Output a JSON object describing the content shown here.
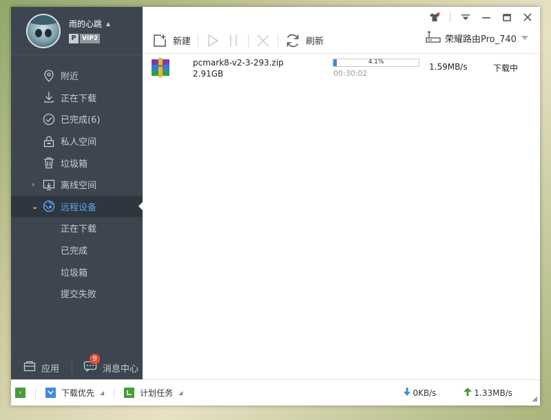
{
  "user": {
    "name": "雨的心跳",
    "vip_p": "P",
    "vip_level": "VIP2"
  },
  "nav": [
    {
      "label": "附近",
      "icon": "location-pin-icon"
    },
    {
      "label": "正在下载",
      "icon": "download-icon"
    },
    {
      "label": "已完成(6)",
      "icon": "check-circle-icon"
    },
    {
      "label": "私人空间",
      "icon": "lock-icon"
    },
    {
      "label": "垃圾箱",
      "icon": "trash-icon"
    },
    {
      "label": "离线空间",
      "icon": "offline-space-icon"
    },
    {
      "label": "远程设备",
      "icon": "remote-device-icon"
    }
  ],
  "subnav": [
    {
      "label": "正在下载"
    },
    {
      "label": "已完成"
    },
    {
      "label": "垃圾箱"
    },
    {
      "label": "提交失败"
    }
  ],
  "sidebar_bottom": {
    "apps_label": "应用",
    "messages_label": "消息中心",
    "messages_badge": "9"
  },
  "toolbar": {
    "new_label": "新建",
    "refresh_label": "刷新"
  },
  "device": {
    "name": "荣耀路由Pro_740"
  },
  "task": {
    "filename": "pcmark8-v2-3-293.zip",
    "size": "2.91GB",
    "progress_text": "4.1%",
    "progress_value": 4.1,
    "elapsed": "00:30:02",
    "speed": "1.59MB/s",
    "status": "下载中"
  },
  "statusbar": {
    "priority_label": "下载优先",
    "schedule_label": "计划任务",
    "down_speed": "0KB/s",
    "up_speed": "1.33MB/s"
  },
  "colors": {
    "sidebar_bg": "#3d4650",
    "active_bg": "#2f363e",
    "accent": "#3b8be0",
    "progress_fill": "#3b8be0",
    "badge": "#e8503a",
    "green": "#4a9a3a"
  }
}
